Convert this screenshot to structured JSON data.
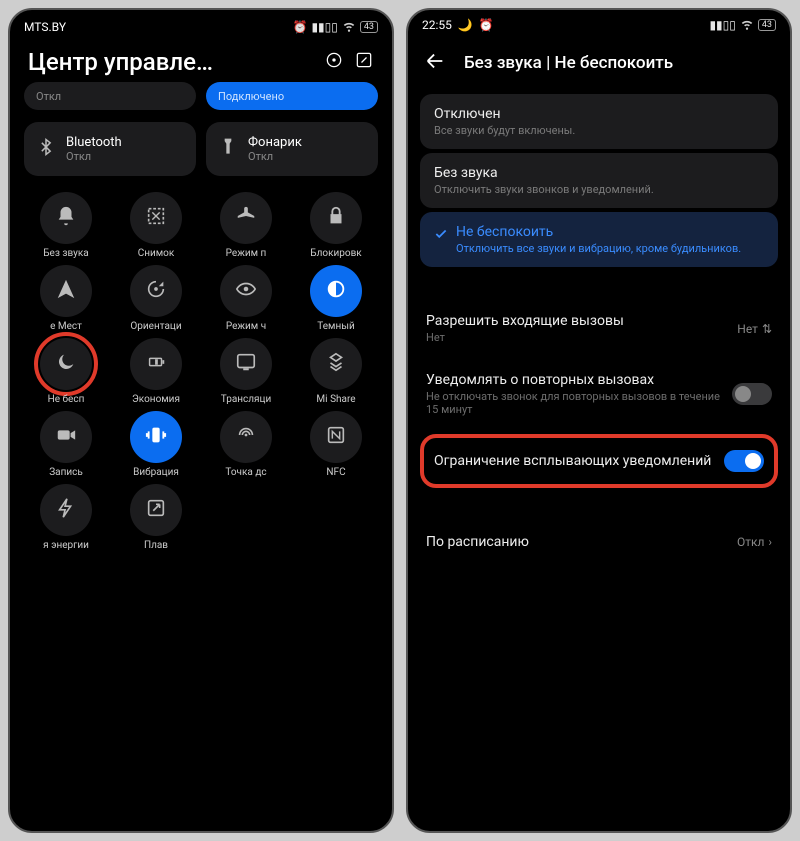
{
  "left": {
    "carrier": "MTS.BY",
    "battery_label": "43",
    "title": "Центр управле…",
    "tile_off_sub": "Откл",
    "tile_connected_sub": "Подключено",
    "tile_bluetooth": "Bluetooth",
    "tile_bluetooth_sub": "Откл",
    "tile_flashlight": "Фонарик",
    "tile_flashlight_sub": "Откл",
    "toggles": [
      {
        "label": "Без звука",
        "icon": "bell"
      },
      {
        "label": "Снимок",
        "icon": "screenshot"
      },
      {
        "label": "Режим п",
        "icon": "airplane"
      },
      {
        "label": "Блокировк",
        "icon": "lock"
      },
      {
        "label": "е   Мест",
        "icon": "location"
      },
      {
        "label": "Ориентаци",
        "icon": "rotation"
      },
      {
        "label": "Режим ч",
        "icon": "eye"
      },
      {
        "label": "Темный",
        "icon": "dark",
        "blue": true
      },
      {
        "label": "Не бесп",
        "icon": "moon",
        "highlight": true
      },
      {
        "label": "Экономия",
        "icon": "battery"
      },
      {
        "label": "Трансляци",
        "icon": "cast"
      },
      {
        "label": "Mi Share",
        "icon": "mishare"
      },
      {
        "label": "Запись",
        "icon": "record"
      },
      {
        "label": "Вибрация",
        "icon": "vibration",
        "blue": true
      },
      {
        "label": "Точка дс",
        "icon": "hotspot"
      },
      {
        "label": "NFC",
        "icon": "nfc"
      },
      {
        "label": "я энергии",
        "icon": "energy"
      },
      {
        "label": "Плав",
        "icon": "float"
      }
    ]
  },
  "right": {
    "time": "22:55",
    "battery_label": "43",
    "title": "Без звука | Не беспокоить",
    "options": [
      {
        "title": "Отключен",
        "desc": "Все звуки будут включены."
      },
      {
        "title": "Без звука",
        "desc": "Отключить звуки звонков и уведомлений."
      },
      {
        "title": "Не беспокоить",
        "desc": "Отключить все звуки и вибрацию, кроме будильников.",
        "selected": true
      }
    ],
    "row_calls_title": "Разрешить входящие вызовы",
    "row_calls_val": "Нет",
    "row_repeat_title": "Уведомлять о повторных вызовах",
    "row_repeat_desc": "Не отключать звонок для повторных вызовов в течение 15 минут",
    "row_popup_title": "Ограничение всплывающих уведомлений",
    "row_schedule_title": "По расписанию",
    "row_schedule_val": "Откл"
  }
}
